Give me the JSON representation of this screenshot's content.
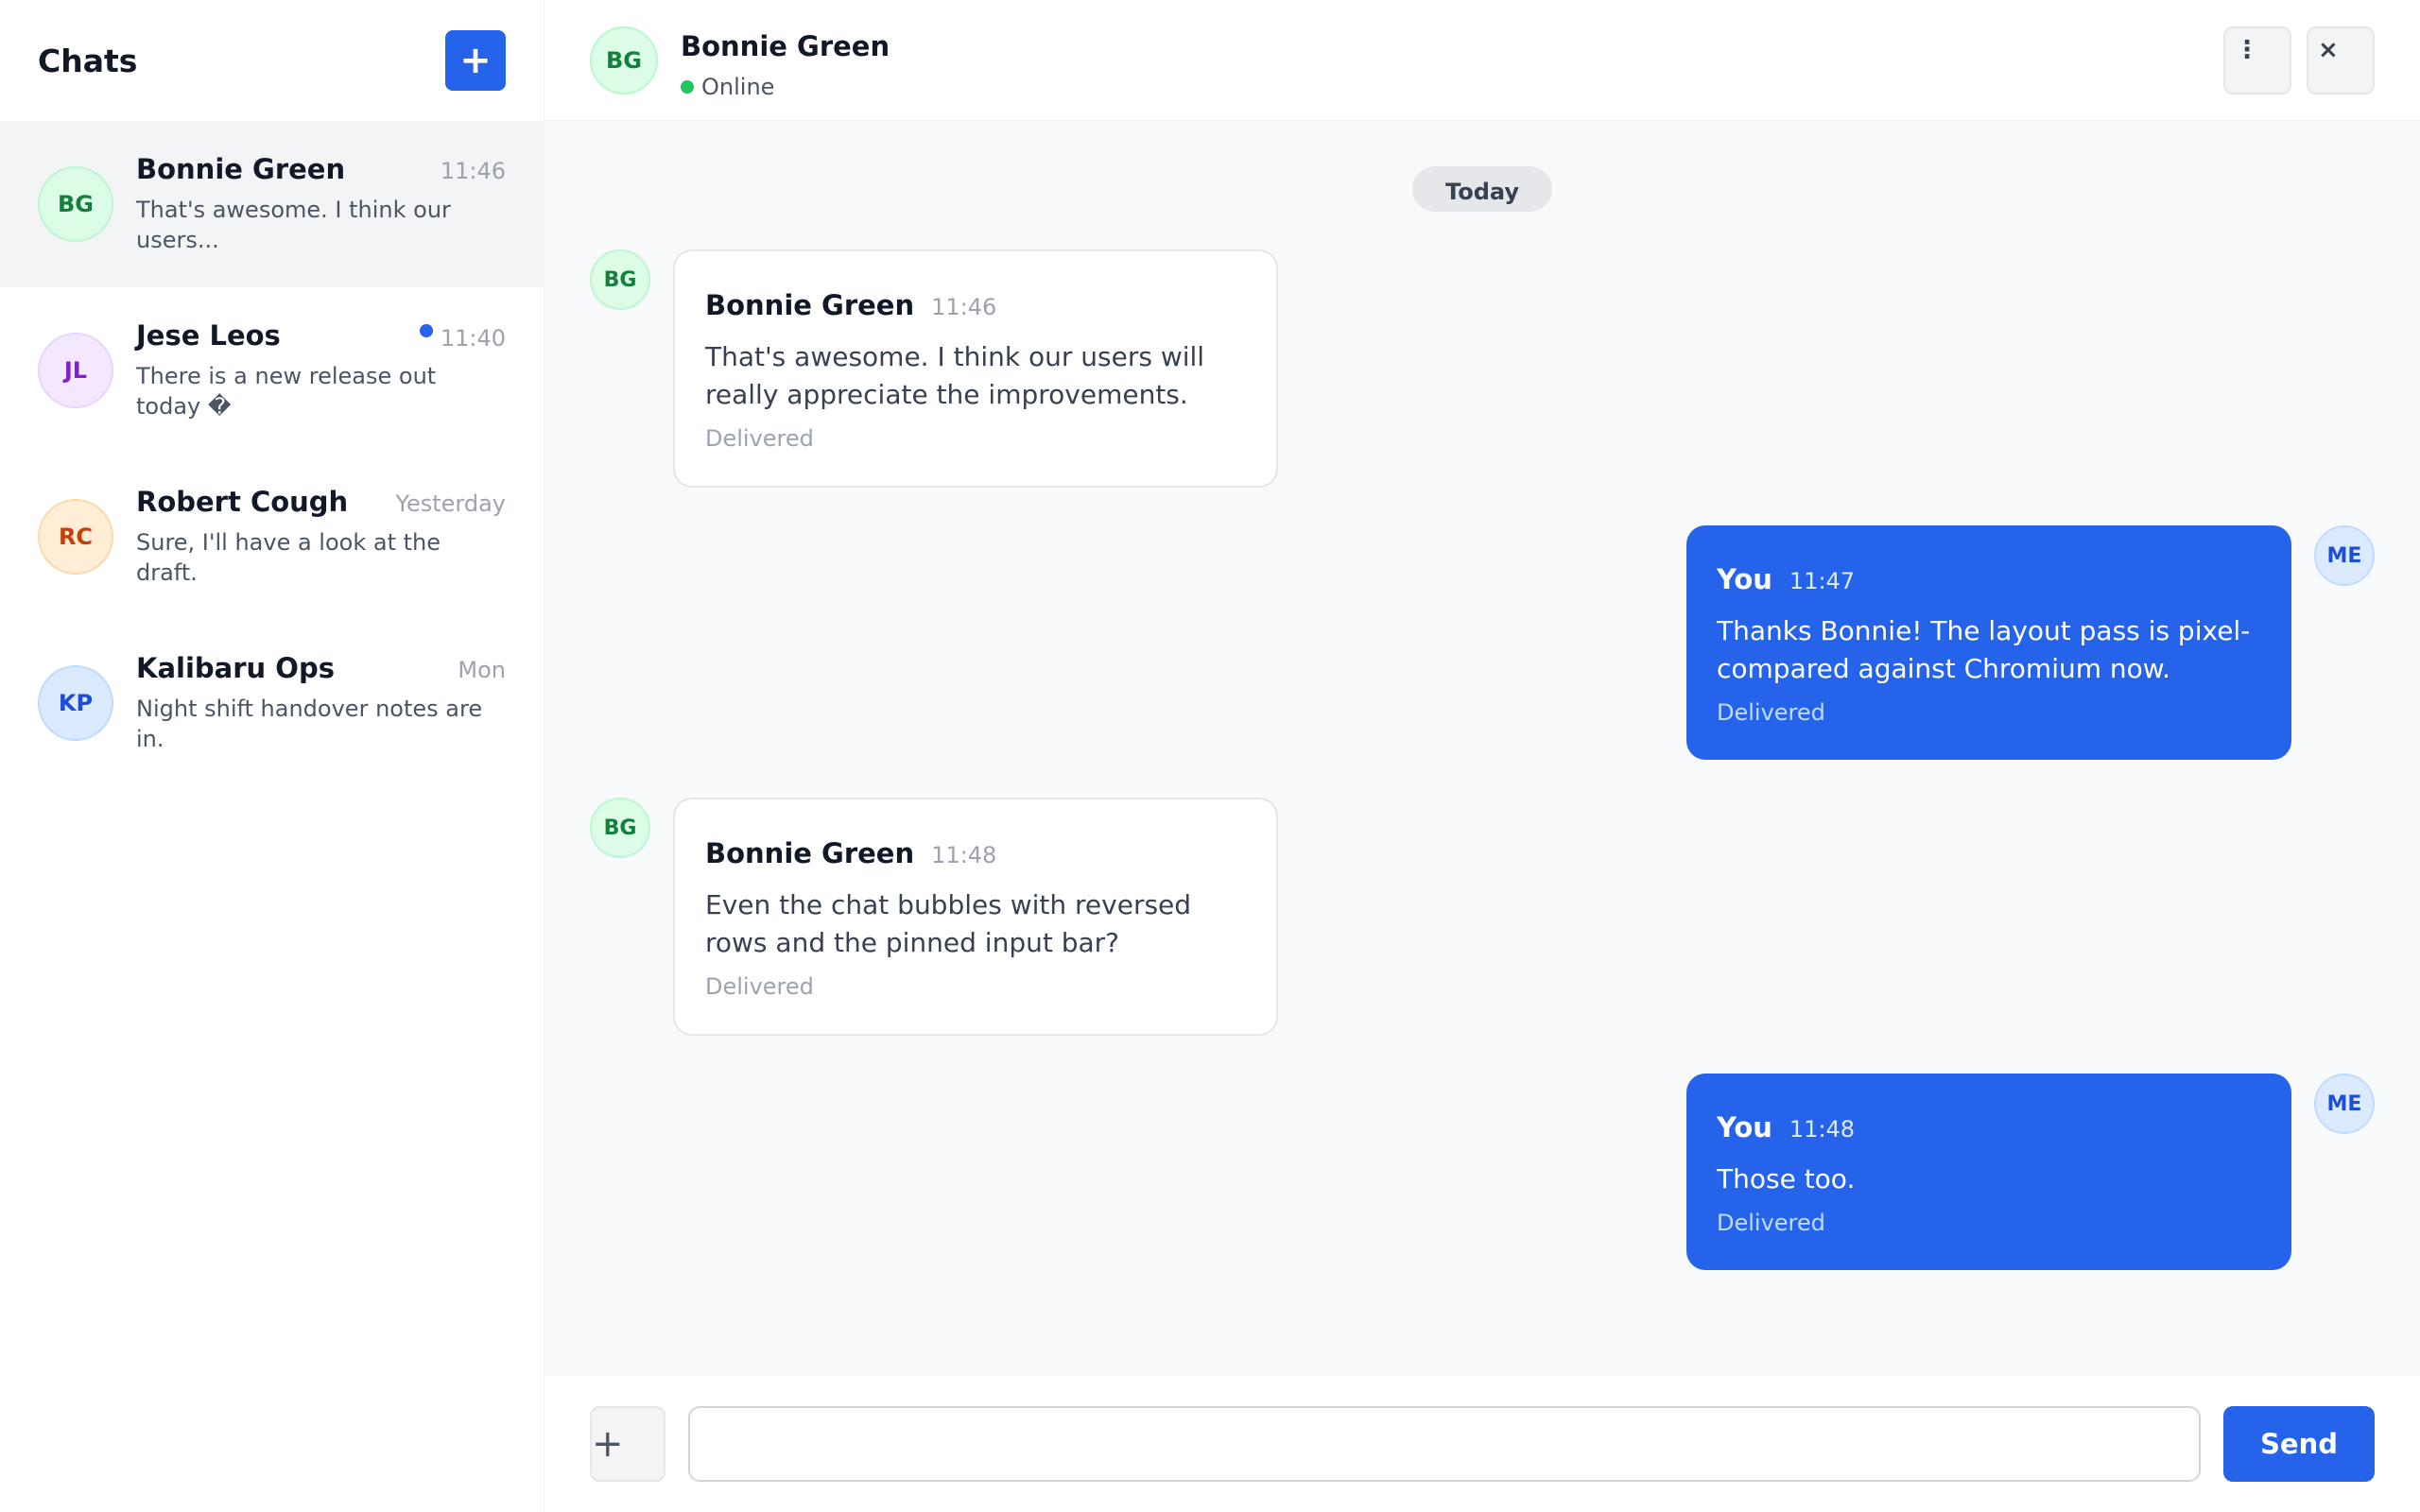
{
  "sidebar": {
    "title": "Chats",
    "new_chat_icon": "+",
    "conversations": [
      {
        "initials": "BG",
        "name": "Bonnie Green",
        "time": "11:46",
        "preview": "That's awesome. I think our users...",
        "unread": false,
        "active": true
      },
      {
        "initials": "JL",
        "name": "Jese Leos",
        "time": "11:40",
        "preview": "There is a new release out today �",
        "unread": true,
        "active": false
      },
      {
        "initials": "RC",
        "name": "Robert Cough",
        "time": "Yesterday",
        "preview": "Sure, I'll have a look at the draft.",
        "unread": false,
        "active": false
      },
      {
        "initials": "KP",
        "name": "Kalibaru Ops",
        "time": "Mon",
        "preview": "Night shift handover notes are in.",
        "unread": false,
        "active": false
      }
    ]
  },
  "header": {
    "initials": "BG",
    "name": "Bonnie Green",
    "status": "Online",
    "more_icon": "⋮",
    "close_icon": "×"
  },
  "thread": {
    "date_label": "Today",
    "messages": [
      {
        "initials": "BG",
        "sender": "Bonnie Green",
        "time": "11:46",
        "text": "That's awesome. I think our users will really appreciate the improvements.",
        "status": "Delivered"
      },
      {
        "initials": "ME",
        "sender": "You",
        "time": "11:47",
        "text": "Thanks Bonnie! The layout pass is pixel-compared against Chromium now.",
        "status": "Delivered"
      },
      {
        "initials": "BG",
        "sender": "Bonnie Green",
        "time": "11:48",
        "text": "Even the chat bubbles with reversed rows and the pinned input bar?",
        "status": "Delivered"
      },
      {
        "initials": "ME",
        "sender": "You",
        "time": "11:48",
        "text": "Those too.",
        "status": "Delivered"
      }
    ]
  },
  "composer": {
    "attach_icon": "+",
    "input_value": "",
    "input_placeholder": "",
    "send_label": "Send"
  },
  "colors": {
    "accent": "#2563eb",
    "online": "#22c55e",
    "unread": "#2563eb"
  }
}
